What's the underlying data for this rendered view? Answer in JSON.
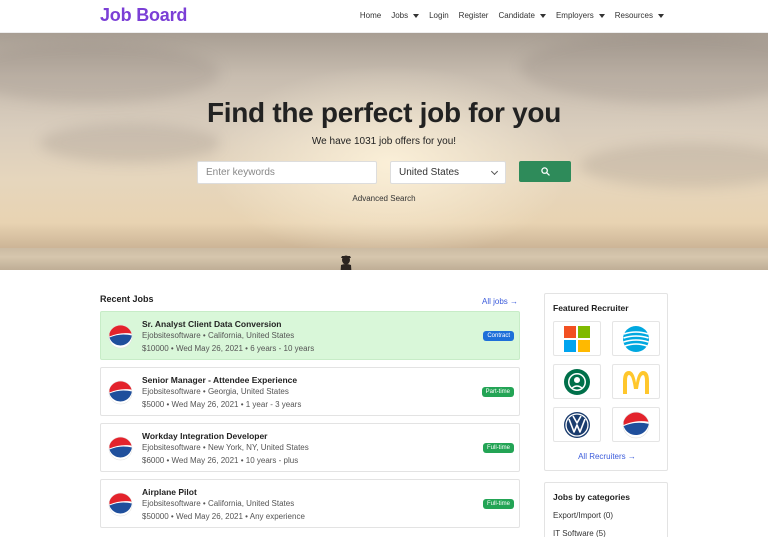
{
  "nav": {
    "logo": "Job Board",
    "items": [
      {
        "label": "Home",
        "dropdown": false
      },
      {
        "label": "Jobs",
        "dropdown": true
      },
      {
        "label": "Login",
        "dropdown": false
      },
      {
        "label": "Register",
        "dropdown": false
      },
      {
        "label": "Candidate",
        "dropdown": true
      },
      {
        "label": "Employers",
        "dropdown": true
      },
      {
        "label": "Resources",
        "dropdown": true
      }
    ]
  },
  "hero": {
    "title": "Find the perfect job for you",
    "subtitle": "We have 1031 job offers for you!",
    "keywords_placeholder": "Enter keywords",
    "country_value": "United States",
    "search_icon": "search-icon",
    "advanced_search": "Advanced Search"
  },
  "recent": {
    "title": "Recent Jobs",
    "all_jobs": "All jobs →",
    "jobs": [
      {
        "title": "Sr. Analyst Client Data Conversion",
        "company": "Ejobsitesoftware • California, United States",
        "meta": "$10000 • Wed May 26, 2021 • 6 years - 10 years",
        "badge": "Contract",
        "highlight": true
      },
      {
        "title": "Senior Manager - Attendee Experience",
        "company": "Ejobsitesoftware • Georgia, United States",
        "meta": "$5000 • Wed May 26, 2021 • 1 year - 3 years",
        "badge": "Part-time",
        "highlight": false
      },
      {
        "title": "Workday Integration Developer",
        "company": "Ejobsitesoftware • New York, NY, United States",
        "meta": "$6000 • Wed May 26, 2021 • 10 years - plus",
        "badge": "Full-time",
        "highlight": false
      },
      {
        "title": "Airplane Pilot",
        "company": "Ejobsitesoftware • California, United States",
        "meta": "$50000 • Wed May 26, 2021 • Any experience",
        "badge": "Full-time",
        "highlight": false
      }
    ]
  },
  "featured": {
    "title": "Featured Recruiter",
    "recruiters": [
      "windows-logo",
      "att-logo",
      "starbucks-logo",
      "mcdonalds-logo",
      "volkswagen-logo",
      "pepsi-logo"
    ],
    "all_recruiters": "All Recruiters →"
  },
  "categories": {
    "title": "Jobs by categories",
    "items": [
      "Export/Import (0)",
      "IT Software (5)"
    ]
  },
  "colors": {
    "brand": "#7b3fd6",
    "search_button": "#2e8b5a",
    "link": "#3b5bdb",
    "highlight_row": "#d9f7d9",
    "contract_badge": "#1e6fd9",
    "type_badge": "#23a455"
  }
}
